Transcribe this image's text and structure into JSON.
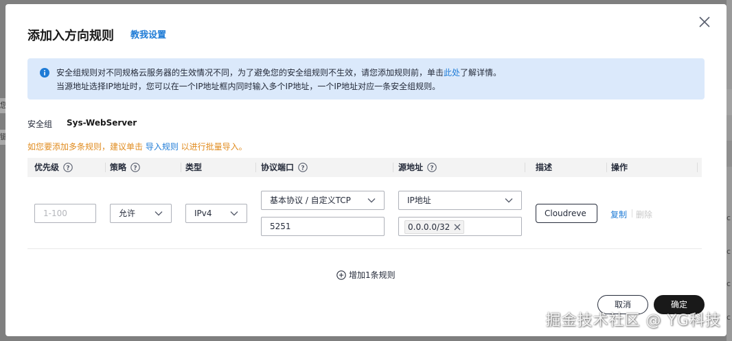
{
  "background": {
    "left_fragments": [
      "您",
      "键"
    ],
    "right_fragments": [
      "c",
      "c",
      "c",
      "c"
    ]
  },
  "dialog": {
    "title": "添加入方向规则",
    "tutorial_link": "教我设置",
    "close_icon": "close-icon"
  },
  "notice": {
    "line1_before": "安全组规则对不同规格云服务器的生效情况不同，为了避免您的安全组规则不生效，请您添加规则前，单击",
    "line1_link": "此处",
    "line1_after": "了解详情。",
    "line2": "当源地址选择IP地址时，您可以在一个IP地址框内同时输入多个IP地址，一个IP地址对应一条安全组规则。",
    "icon": "info-icon"
  },
  "security_group": {
    "label": "安全组",
    "value": "Sys-WebServer"
  },
  "bulk_tip": {
    "before": "如您要添加多条规则，建议单击 ",
    "link": "导入规则",
    "after": " 以进行批量导入。"
  },
  "table": {
    "headers": {
      "priority": "优先级",
      "policy": "策略",
      "type": "类型",
      "protocol_port": "协议端口",
      "source": "源地址",
      "description": "描述",
      "operation": "操作"
    },
    "row": {
      "priority_placeholder": "1-100",
      "policy": "允许",
      "type": "IPv4",
      "protocol": "基本协议 / 自定义TCP",
      "port": "5251",
      "source_type": "IP地址",
      "source_ip": "0.0.0.0/32",
      "description": "Cloudreve",
      "copy_label": "复制",
      "delete_label": "删除"
    }
  },
  "add_rule_label": "增加1条规则",
  "footer": {
    "cancel_label": "取消",
    "ok_label": "确定"
  },
  "watermark": "掘金技术社区 @ YG科技",
  "colors": {
    "link": "#1e7bd6",
    "warning": "#e08b1e",
    "notice_bg": "#dbe9fb",
    "primary_button": "#191919"
  }
}
